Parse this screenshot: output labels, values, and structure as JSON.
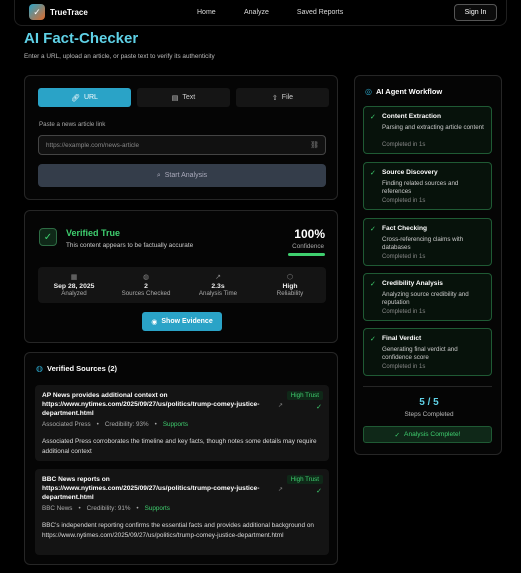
{
  "nav": {
    "brand": "TrueTrace",
    "links": [
      "Home",
      "Analyze",
      "Saved Reports"
    ],
    "signin_label": "Sign In"
  },
  "header": {
    "title": "AI Fact-Checker",
    "subtitle": "Enter a URL, upload an article, or paste text to verify its authenticity"
  },
  "input": {
    "tabs": [
      {
        "label": "URL",
        "icon": "link-icon",
        "active": true
      },
      {
        "label": "Text",
        "icon": "document-icon",
        "active": false
      },
      {
        "label": "File",
        "icon": "upload-icon",
        "active": false
      }
    ],
    "field_label": "Paste a news article link",
    "placeholder": "https://example.com/news-article",
    "start_label": "Start Analysis"
  },
  "result": {
    "verdict": "Verified True",
    "verdict_sub": "This content appears to be factually accurate",
    "confidence_value": "100%",
    "confidence_fraction": 1.0,
    "confidence_label": "Confidence",
    "stats": [
      {
        "icon": "calendar-icon",
        "value": "Sep 28, 2025",
        "label": "Analyzed"
      },
      {
        "icon": "globe-icon",
        "value": "2",
        "label": "Sources Checked"
      },
      {
        "icon": "trend-icon",
        "value": "2.3s",
        "label": "Analysis Time"
      },
      {
        "icon": "shield-icon",
        "value": "High",
        "label": "Reliability"
      }
    ],
    "evidence_label": "Show Evidence"
  },
  "sources": {
    "title": "Verified Sources (2)",
    "items": [
      {
        "headline": "AP News provides additional context on https://www.nytimes.com/2025/09/27/us/politics/trump-comey-justice-department.html",
        "trust": "High Trust",
        "outlet": "Associated Press",
        "credibility": "Credibility: 93%",
        "stance": "Supports",
        "description": "Associated Press corroborates the timeline and key facts, though notes some details may require additional context"
      },
      {
        "headline": "BBC News reports on https://www.nytimes.com/2025/09/27/us/politics/trump-comey-justice-department.html",
        "trust": "High Trust",
        "outlet": "BBC News",
        "credibility": "Credibility: 91%",
        "stance": "Supports",
        "description": "BBC's independent reporting confirms the essential facts and provides additional background on https://www.nytimes.com/2025/09/27/us/politics/trump-comey-justice-department.html"
      }
    ]
  },
  "workflow": {
    "title": "AI Agent Workflow",
    "steps": [
      {
        "name": "Content Extraction",
        "desc": "Parsing and extracting article content",
        "done": "Completed in 1s"
      },
      {
        "name": "Source Discovery",
        "desc": "Finding related sources and references",
        "done": "Completed in 1s"
      },
      {
        "name": "Fact Checking",
        "desc": "Cross-referencing claims with databases",
        "done": "Completed in 1s"
      },
      {
        "name": "Credibility Analysis",
        "desc": "Analyzing source credibility and reputation",
        "done": "Completed in 1s"
      },
      {
        "name": "Final Verdict",
        "desc": "Generating final verdict and confidence score",
        "done": "Completed in 1s"
      }
    ],
    "count": "5 / 5",
    "count_label": "Steps Completed",
    "complete_label": "Analysis Complete!"
  },
  "colors": {
    "accent": "#2aa3c7",
    "title": "#5fd1e6",
    "success": "#3fcf6f",
    "background": "#000000"
  }
}
